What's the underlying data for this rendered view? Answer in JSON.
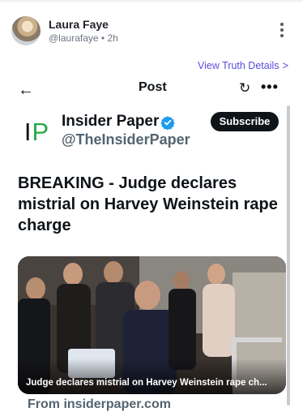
{
  "post": {
    "author_name": "Laura Faye",
    "author_handle": "@laurafaye",
    "time": "2h",
    "meta_separator": "•",
    "view_details_label": "View Truth Details",
    "view_details_chevron": ">"
  },
  "embed": {
    "back_icon": "arrow-left-icon",
    "back_glyph": "←",
    "title": "Post",
    "refresh_icon": "refresh-icon",
    "refresh_glyph": "↻",
    "more_glyph": "•••",
    "account": {
      "logo_letters": [
        "I",
        "P"
      ],
      "name": "Insider Paper",
      "handle": "@TheInsiderPaper",
      "verified": true,
      "subscribe_label": "Subscribe"
    },
    "headline": "BREAKING - Judge declares mistrial on Harvey Weinstein rape charge",
    "media_caption": "Judge declares mistrial on Harvey Weinstein rape ch...",
    "link_domain": "From insiderpaper.com"
  },
  "colors": {
    "link": "#5a4cdb",
    "logo_green": "#2aa84a",
    "verified_blue": "#1d9bf0",
    "button_bg": "#0f1419"
  }
}
